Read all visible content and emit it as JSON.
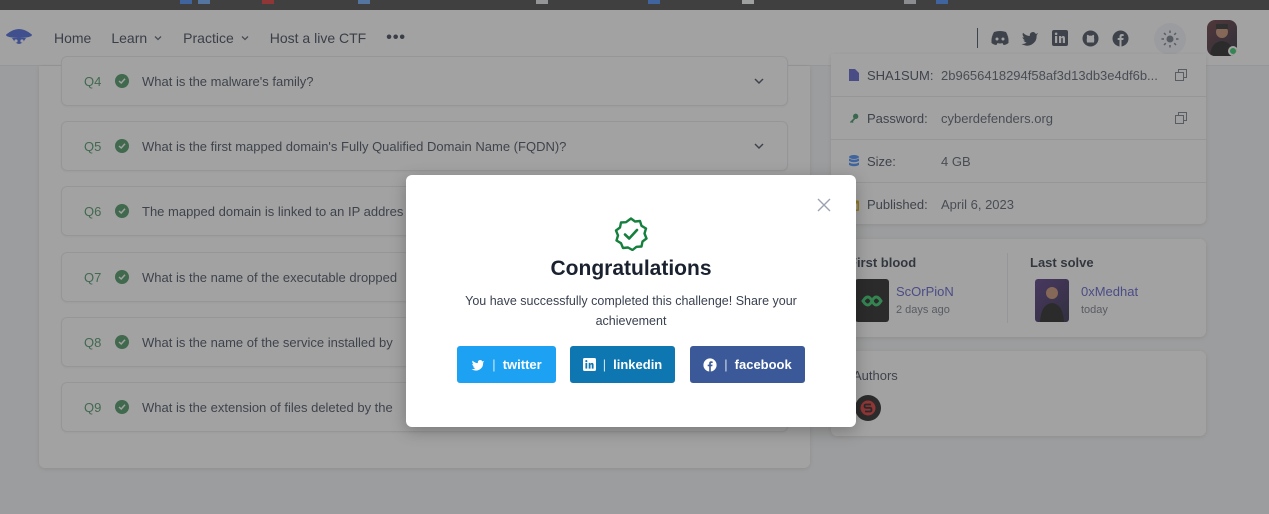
{
  "nav": {
    "items": [
      {
        "label": "Home",
        "has_menu": false
      },
      {
        "label": "Learn",
        "has_menu": true
      },
      {
        "label": "Practice",
        "has_menu": true
      },
      {
        "label": "Host a live CTF",
        "has_menu": false
      }
    ],
    "more_label": "•••",
    "social_icons": [
      "discord-icon",
      "twitter-icon",
      "linkedin-icon",
      "github-icon",
      "facebook-icon"
    ],
    "theme_icon": "sun-icon"
  },
  "questions": [
    {
      "num": "Q4",
      "text": "What is the malware's family?",
      "expandable": true
    },
    {
      "num": "Q5",
      "text": "What is the first mapped domain's Fully Qualified Domain Name (FQDN)?",
      "expandable": true
    },
    {
      "num": "Q6",
      "text": "The mapped domain is linked to an IP addres",
      "expandable": false
    },
    {
      "num": "Q7",
      "text": "What is the name of the executable dropped",
      "expandable": false
    },
    {
      "num": "Q8",
      "text": "What is the name of the service installed by",
      "expandable": false
    },
    {
      "num": "Q9",
      "text": "What is the extension of files deleted by the",
      "expandable": false
    }
  ],
  "info": [
    {
      "icon": "file-icon",
      "label": "SHA1SUM:",
      "value": "2b9656418294f58af3d13db3e4df6b...",
      "copy": true
    },
    {
      "icon": "key-icon",
      "label": "Password:",
      "value": "cyberdefenders.org",
      "copy": true
    },
    {
      "icon": "database-icon",
      "label": "Size:",
      "value": "4 GB",
      "copy": false
    },
    {
      "icon": "calendar-icon",
      "label": "Published:",
      "value": "April 6, 2023",
      "copy": false
    }
  ],
  "first_blood": {
    "title": "First blood",
    "name": "ScOrPioN",
    "when": "2 days ago"
  },
  "last_solve": {
    "title": "Last solve",
    "name": "0xMedhat",
    "when": "today"
  },
  "authors": {
    "title": "Authors"
  },
  "modal": {
    "title": "Congratulations",
    "message": "You have successfully completed this challenge! Share your achievement",
    "buttons": {
      "twitter": "twitter",
      "linkedin": "linkedin",
      "facebook": "facebook"
    },
    "separator": "|",
    "colors": {
      "twitter": "#1da1f2",
      "linkedin": "#0e76b0",
      "facebook": "#3b5998",
      "success": "#15803d"
    }
  }
}
